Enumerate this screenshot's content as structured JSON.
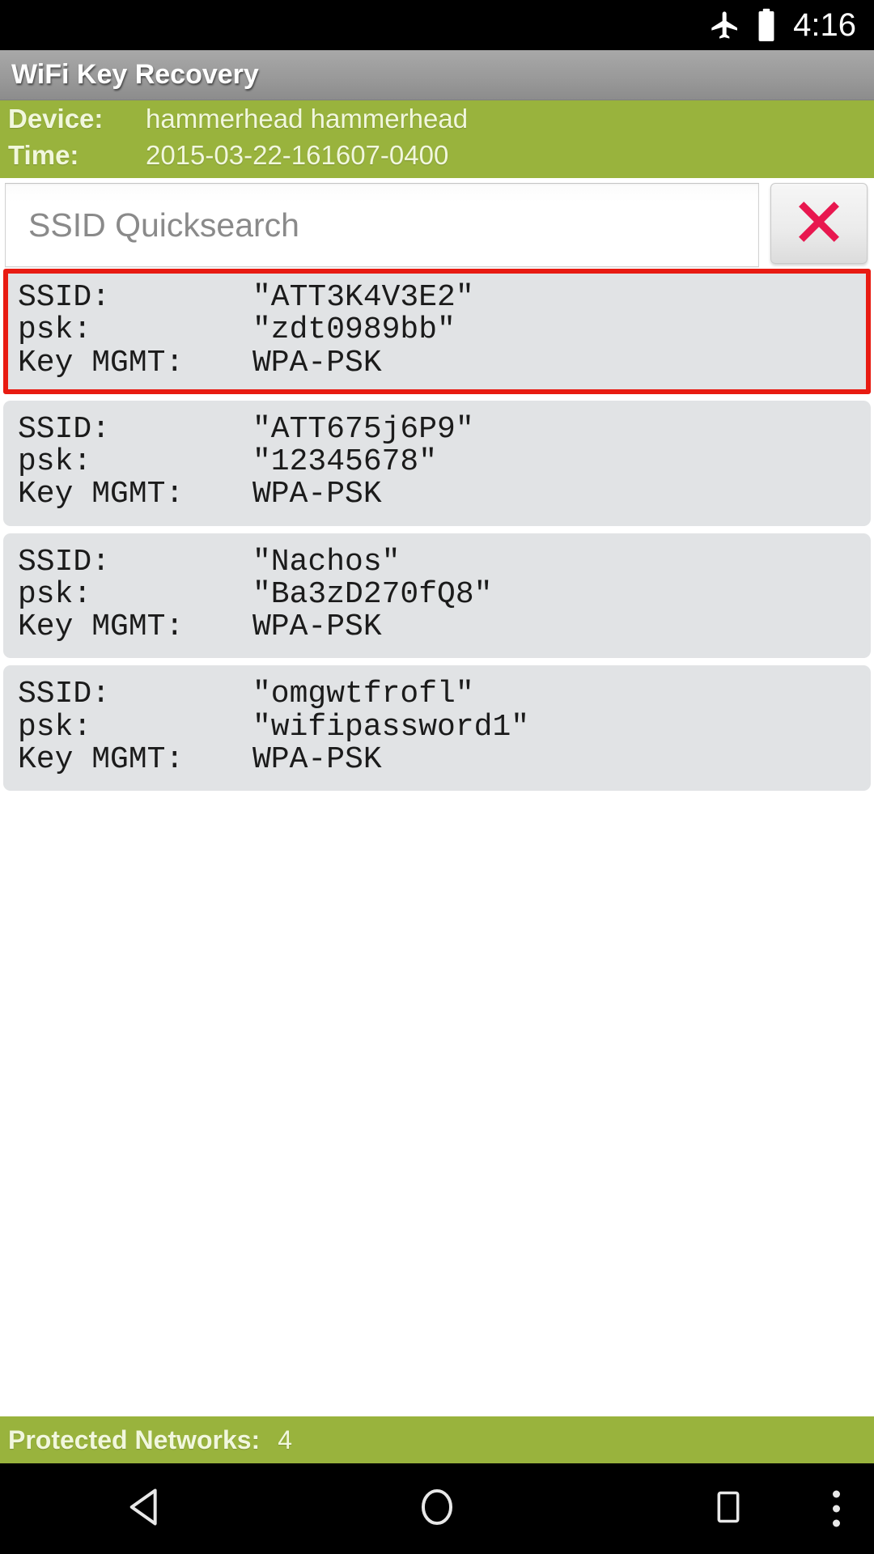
{
  "statusbar": {
    "airplane_icon": "airplane-mode-icon",
    "battery_icon": "battery-full-icon",
    "time": "4:16"
  },
  "titlebar": {
    "title": "WiFi Key Recovery"
  },
  "info": {
    "device_label": "Device:",
    "device_value": "hammerhead hammerhead",
    "time_label": "Time:",
    "time_value": "2015-03-22-161607-0400"
  },
  "search": {
    "placeholder": "SSID Quicksearch",
    "value": "",
    "clear_icon": "clear-x-icon",
    "clear_color": "#e8174f"
  },
  "networks": [
    {
      "ssid_label": "SSID:",
      "ssid_value": "\"ATT3K4V3E2\"",
      "psk_label": "psk:",
      "psk_value": "\"zdt0989bb\"",
      "keymgmt_label": "Key MGMT:",
      "keymgmt_value": "WPA-PSK",
      "selected": true
    },
    {
      "ssid_label": "SSID:",
      "ssid_value": "\"ATT675j6P9\"",
      "psk_label": "psk:",
      "psk_value": "\"12345678\"",
      "keymgmt_label": "Key MGMT:",
      "keymgmt_value": "WPA-PSK",
      "selected": false
    },
    {
      "ssid_label": "SSID:",
      "ssid_value": "\"Nachos\"",
      "psk_label": "psk:",
      "psk_value": "\"Ba3zD270fQ8\"",
      "keymgmt_label": "Key MGMT:",
      "keymgmt_value": "WPA-PSK",
      "selected": false
    },
    {
      "ssid_label": "SSID:",
      "ssid_value": "\"omgwtfrofl\"",
      "psk_label": "psk:",
      "psk_value": "\"wifipassword1\"",
      "keymgmt_label": "Key MGMT:",
      "keymgmt_value": "WPA-PSK",
      "selected": false
    }
  ],
  "footer": {
    "label": "Protected Networks:",
    "count": "4"
  },
  "navbar": {
    "back_icon": "back-triangle-icon",
    "home_icon": "home-circle-icon",
    "recents_icon": "recents-square-icon",
    "overflow_icon": "overflow-dots-icon"
  },
  "colors": {
    "accent_green": "#99b33d",
    "selection_red": "#e81b12",
    "card_gray": "#e1e3e5",
    "titlebar_gray": "#9a9a9a"
  }
}
